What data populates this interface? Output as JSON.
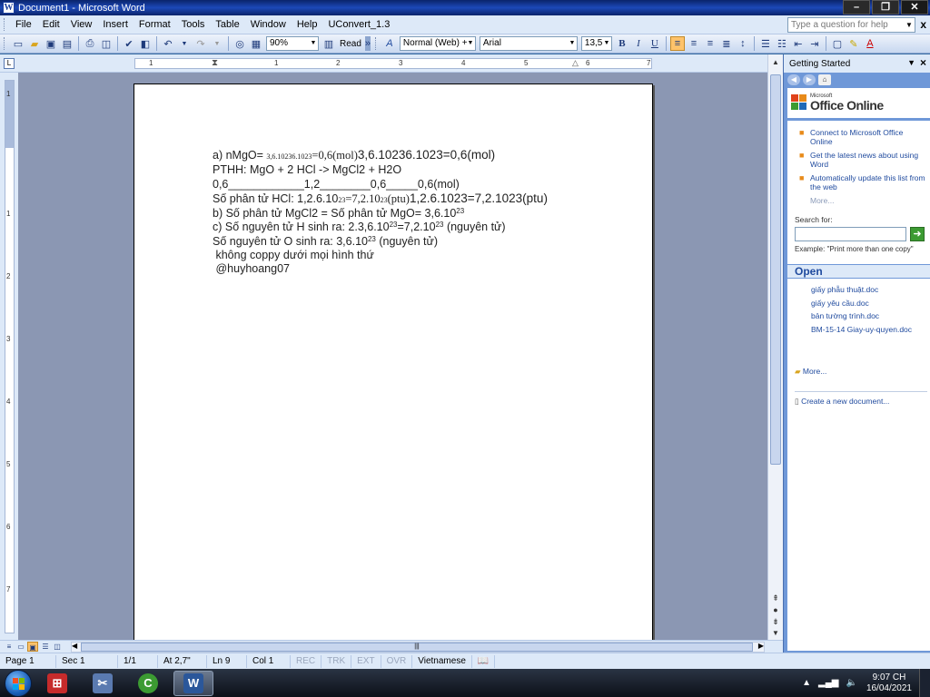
{
  "window": {
    "title": "Document1 - Microsoft Word",
    "app_icon_letter": "W",
    "controls": [
      "–",
      "❐",
      "✕"
    ]
  },
  "menu": {
    "items": [
      "File",
      "Edit",
      "View",
      "Insert",
      "Format",
      "Tools",
      "Table",
      "Window",
      "Help",
      "UConvert_1.3"
    ],
    "help_placeholder": "Type a question for help",
    "close_symbol": "x"
  },
  "toolbar": {
    "zoom": "90%",
    "read_label": "Read",
    "style": "Normal (Web) +",
    "font": "Arial",
    "font_size": "13,5",
    "bold": "B",
    "italic": "I",
    "underline": "U"
  },
  "ruler": {
    "h_numbers": [
      "1",
      "1",
      "2",
      "3",
      "4",
      "5",
      "6",
      "7"
    ],
    "v_numbers": [
      "1",
      "1",
      "2",
      "3",
      "4",
      "5",
      "6",
      "7"
    ]
  },
  "document": {
    "line1": {
      "a": "a) nMgO= ",
      "b": "3,6.10",
      "c": "23",
      "d": "6.10",
      "e": "23",
      "f": "=0,6(mol)",
      "g": "3,6.10236.1023=0,6(mol)"
    },
    "line2": "PTHH: MgO + 2 HCl -> MgCl2 + H2O",
    "line3": "0,6____________1,2________0,6_____0,6(mol)",
    "line4": {
      "a": "Số phân tử HCl: 1,2.6.10",
      "b": "23",
      "c": "=7,2.10",
      "d": "23",
      "e": "(ptu)",
      "f": "1,2.6.1023=7,2.1023(ptu)"
    },
    "line5": {
      "a": "b) Số phân tử MgCl2 = Số phân tử MgO= 3,6.10",
      "b": "23"
    },
    "line6": {
      "a": "c) Số nguyên tử H sinh ra: 2.3,6.10",
      "b": "23",
      "c": "=7,2.10",
      "d": "23",
      "e": " (nguyên tử)"
    },
    "line7": {
      "a": "Số nguyên tử O sinh ra: 3,6.10",
      "b": "23",
      "c": " (nguyên tử)"
    },
    "line8": " không coppy dưới mọi hình thứ",
    "line9": " @huyhoang07"
  },
  "taskpane": {
    "title": "Getting Started",
    "logo_ms": "Microsoft",
    "logo_text": "Office Online",
    "links": [
      "Connect to Microsoft Office Online",
      "Get the latest news about using Word",
      "Automatically update this list from the web"
    ],
    "more": "More...",
    "search_label": "Search for:",
    "search_value": "",
    "example": "Example:  \"Print more than one copy\"",
    "open_header": "Open",
    "files": [
      "giấy phẫu thuật.doc",
      "giấy yêu cầu.doc",
      "bản tường trình.doc",
      "BM-15-14 Giay-uy-quyen.doc"
    ],
    "more_files": "More...",
    "create_new": "Create a new document..."
  },
  "status": {
    "page": "Page  1",
    "sec": "Sec  1",
    "pages": "1/1",
    "at": "At  2,7\"",
    "ln": "Ln  9",
    "col": "Col  1",
    "rec": "REC",
    "trk": "TRK",
    "ext": "EXT",
    "ovr": "OVR",
    "language": "Vietnamese"
  },
  "taskbar": {
    "time": "9:07 CH",
    "date": "16/04/2021"
  },
  "colors": {
    "title_bar": "#0a246a",
    "menu_bg": "#dde9f8",
    "taskpane_bg": "#6f98d8",
    "doc_bg": "#8b97b3",
    "link": "#1f4a9e",
    "bullet": "#e88b1a"
  }
}
